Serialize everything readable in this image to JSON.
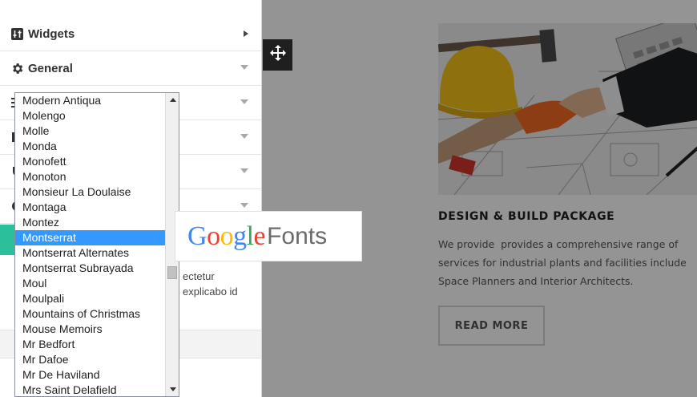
{
  "panel": {
    "sections": [
      {
        "label": "Widgets",
        "icon": "widgets-icon",
        "arrow": "right"
      },
      {
        "label": "General",
        "icon": "gear-icon",
        "arrow": "down"
      },
      {
        "label": "",
        "icon": "menu-icon",
        "arrow": "down"
      },
      {
        "label": "",
        "icon": "layout-icon",
        "arrow": "down"
      },
      {
        "label": "",
        "icon": "shield-icon",
        "arrow": "down"
      },
      {
        "label": "",
        "icon": "circle-icon",
        "arrow": "down"
      }
    ],
    "body_text_line1": "ectetur",
    "body_text_line2": "explicabo id"
  },
  "dropdown": {
    "selected": "Montserrat",
    "options": [
      "Modern Antiqua",
      "Molengo",
      "Molle",
      "Monda",
      "Monofett",
      "Monoton",
      "Monsieur La Doulaise",
      "Montaga",
      "Montez",
      "Montserrat",
      "Montserrat Alternates",
      "Montserrat Subrayada",
      "Moul",
      "Moulpali",
      "Mountains of Christmas",
      "Mouse Memoirs",
      "Mr Bedfort",
      "Mr Dafoe",
      "Mr De Haviland",
      "Mrs Saint Delafield"
    ]
  },
  "google_fonts_badge": {
    "google_letters": [
      "G",
      "o",
      "o",
      "g",
      "l",
      "e"
    ],
    "google_colors": [
      "#4285F4",
      "#EA4335",
      "#FBBC05",
      "#4285F4",
      "#34A853",
      "#EA4335"
    ],
    "fonts_word": "Fonts"
  },
  "preview": {
    "feature_title": "DESIGN & BUILD PACKAGE",
    "feature_text": "We provide  provides a comprehensive range of\nservices for industrial plants and facilities include\nSpace Planners and Interior Architects.",
    "read_more_label": "READ MORE"
  },
  "colors": {
    "accent_teal": "#2bbf9b",
    "selection_blue": "#3399ff",
    "handle_dark": "#1f1f1f"
  }
}
